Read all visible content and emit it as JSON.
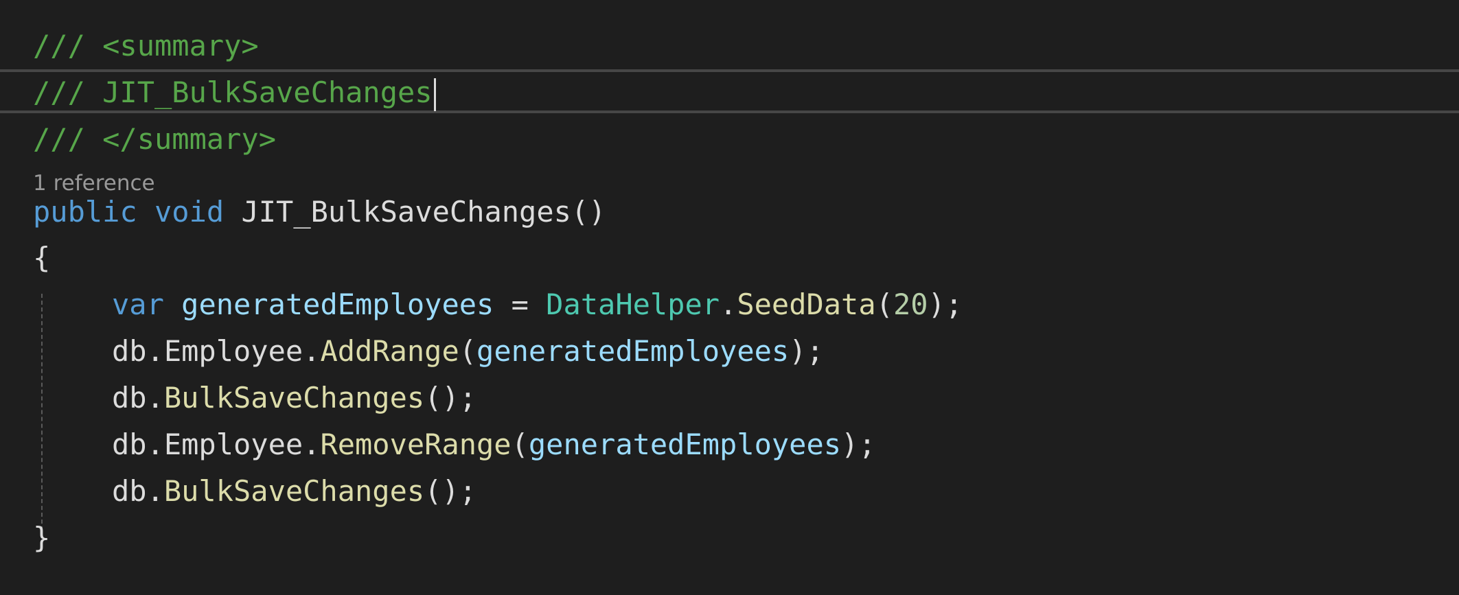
{
  "editor": {
    "codelens": "1 reference",
    "lines": [
      {
        "tokens": [
          {
            "t": "/// <summary>",
            "c": "comment"
          }
        ]
      },
      {
        "tokens": [
          {
            "t": "/// JIT_BulkSaveChanges",
            "c": "comment"
          }
        ]
      },
      {
        "tokens": [
          {
            "t": "/// </summary>",
            "c": "comment"
          }
        ]
      },
      {
        "tokens": [
          {
            "t": "public",
            "c": "keyword"
          },
          {
            "t": " ",
            "c": "plain"
          },
          {
            "t": "void",
            "c": "keyword"
          },
          {
            "t": " ",
            "c": "plain"
          },
          {
            "t": "JIT_BulkSaveChanges",
            "c": "plain"
          },
          {
            "t": "()",
            "c": "plain"
          }
        ]
      },
      {
        "tokens": [
          {
            "t": "{",
            "c": "plain"
          }
        ]
      },
      {
        "tokens": [
          {
            "t": "var",
            "c": "keyword"
          },
          {
            "t": " ",
            "c": "plain"
          },
          {
            "t": "generatedEmployees",
            "c": "param"
          },
          {
            "t": " = ",
            "c": "plain"
          },
          {
            "t": "DataHelper",
            "c": "type"
          },
          {
            "t": ".",
            "c": "plain"
          },
          {
            "t": "SeedData",
            "c": "method"
          },
          {
            "t": "(",
            "c": "plain"
          },
          {
            "t": "20",
            "c": "number"
          },
          {
            "t": ");",
            "c": "plain"
          }
        ]
      },
      {
        "tokens": [
          {
            "t": "db.Employee.",
            "c": "plain"
          },
          {
            "t": "AddRange",
            "c": "method"
          },
          {
            "t": "(",
            "c": "plain"
          },
          {
            "t": "generatedEmployees",
            "c": "param"
          },
          {
            "t": ");",
            "c": "plain"
          }
        ]
      },
      {
        "tokens": [
          {
            "t": "db.",
            "c": "plain"
          },
          {
            "t": "BulkSaveChanges",
            "c": "method"
          },
          {
            "t": "();",
            "c": "plain"
          }
        ]
      },
      {
        "tokens": [
          {
            "t": "db.Employee.",
            "c": "plain"
          },
          {
            "t": "RemoveRange",
            "c": "method"
          },
          {
            "t": "(",
            "c": "plain"
          },
          {
            "t": "generatedEmployees",
            "c": "param"
          },
          {
            "t": ");",
            "c": "plain"
          }
        ]
      },
      {
        "tokens": [
          {
            "t": "db.",
            "c": "plain"
          },
          {
            "t": "BulkSaveChanges",
            "c": "method"
          },
          {
            "t": "();",
            "c": "plain"
          }
        ]
      },
      {
        "tokens": [
          {
            "t": "}",
            "c": "plain"
          }
        ]
      }
    ]
  },
  "colors": {
    "background": "#1e1e1e",
    "comment": "#57a64a",
    "keyword": "#569cd6",
    "type": "#4ec9b0",
    "method": "#dcdcaa",
    "param": "#9cdcfe",
    "number": "#b5cea8",
    "plain": "#dcdcdc"
  }
}
